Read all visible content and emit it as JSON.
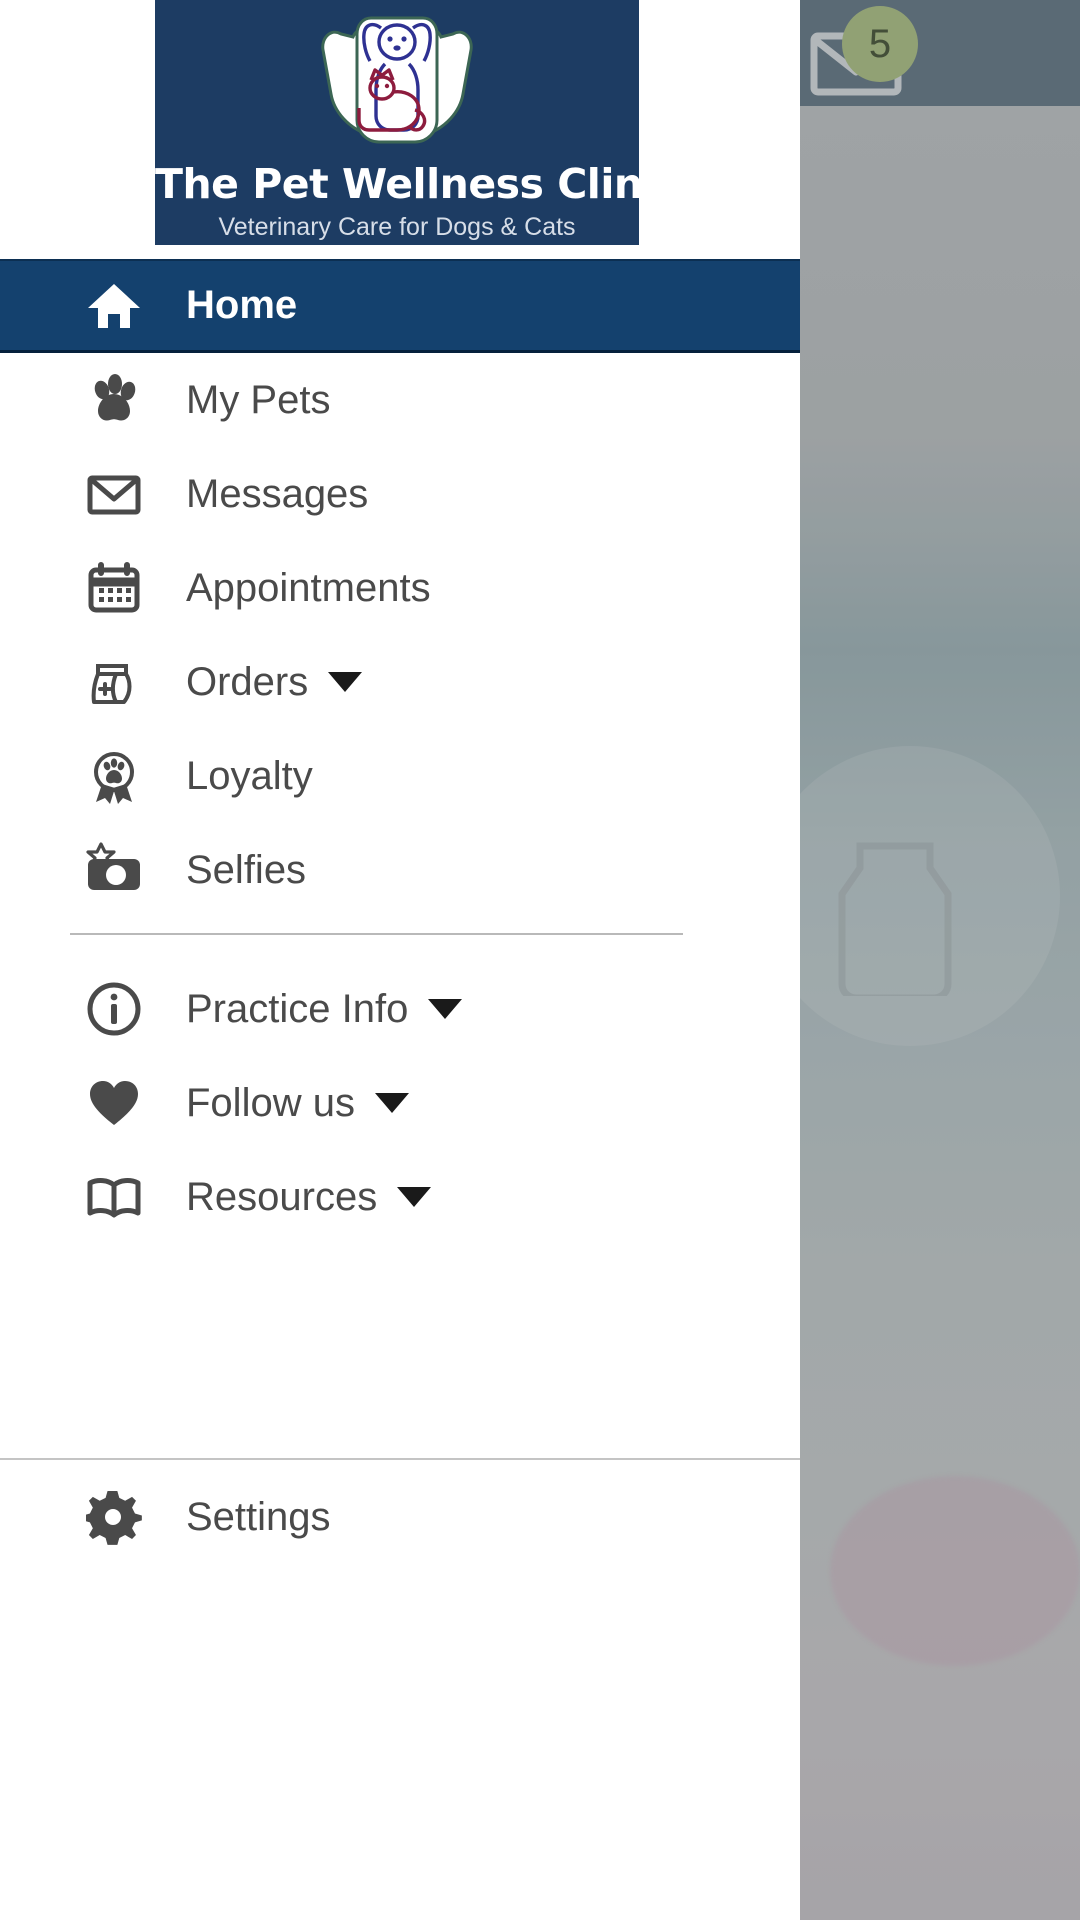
{
  "app": {
    "title": "The Pet Wellness Clinic",
    "tagline": "Veterinary Care for Dogs & Cats"
  },
  "background": {
    "mail_icon": "mail-icon",
    "unread_badge": "5"
  },
  "drawer": {
    "close_icon": "close-icon",
    "logo_icon": "clinic-logo-hands-dog-cat",
    "primary_items": [
      {
        "label": "Home",
        "icon": "home-icon",
        "selected": true,
        "has_caret": false
      },
      {
        "label": "My Pets",
        "icon": "paw-icon",
        "selected": false,
        "has_caret": false
      },
      {
        "label": "Messages",
        "icon": "envelope-icon",
        "selected": false,
        "has_caret": false
      },
      {
        "label": "Appointments",
        "icon": "calendar-icon",
        "selected": false,
        "has_caret": false
      },
      {
        "label": "Orders",
        "icon": "food-bag-icon",
        "selected": false,
        "has_caret": true
      },
      {
        "label": "Loyalty",
        "icon": "award-paw-icon",
        "selected": false,
        "has_caret": false
      },
      {
        "label": "Selfies",
        "icon": "camera-star-icon",
        "selected": false,
        "has_caret": false
      }
    ],
    "secondary_items": [
      {
        "label": "Practice Info",
        "icon": "info-circle-icon",
        "selected": false,
        "has_caret": true
      },
      {
        "label": "Follow us",
        "icon": "heart-icon",
        "selected": false,
        "has_caret": true
      },
      {
        "label": "Resources",
        "icon": "book-icon",
        "selected": false,
        "has_caret": true
      }
    ],
    "footer_items": [
      {
        "label": "Settings",
        "icon": "gear-icon",
        "selected": false,
        "has_caret": false
      }
    ]
  },
  "colors": {
    "brand_navy": "#1d3c63",
    "selected_navy": "#14416e",
    "icon_gray": "#4a4a4a",
    "badge_green": "#b6c98c"
  }
}
